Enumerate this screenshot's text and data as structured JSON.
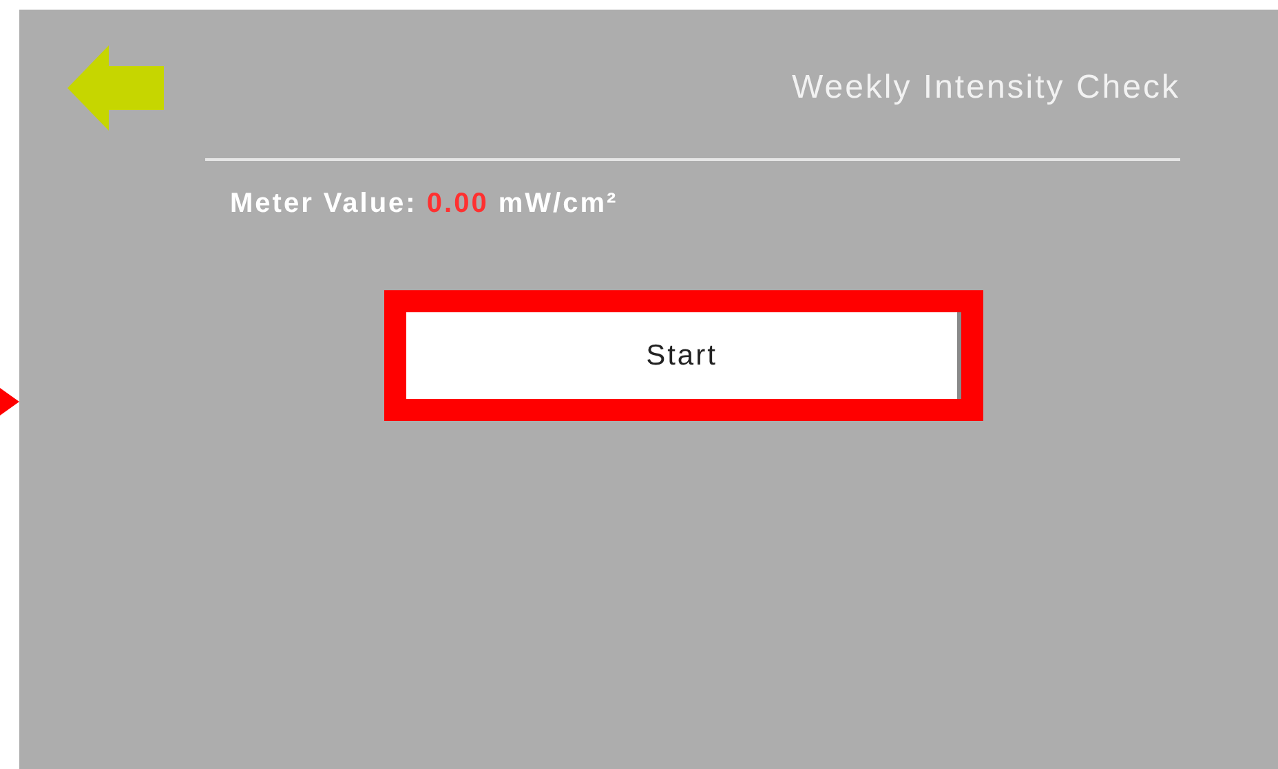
{
  "screen": {
    "title": "Weekly Intensity Check"
  },
  "meter": {
    "label": "Meter Value:",
    "value": "0.00",
    "unit": "mW/cm²"
  },
  "start_button": {
    "label": "Start",
    "highlighted": true
  },
  "pointer": {
    "shown": true
  }
}
